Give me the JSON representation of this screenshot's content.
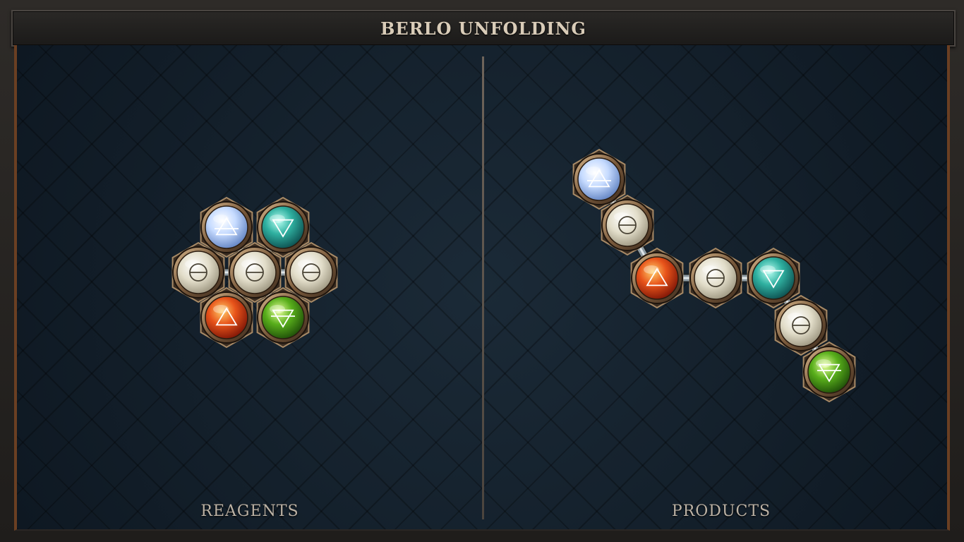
{
  "header": {
    "title": "BERLO UNFOLDING"
  },
  "panels": {
    "reagents_label": "REAGENTS",
    "products_label": "PRODUCTS"
  },
  "atom_types": {
    "air": {
      "symbol": "🜁",
      "icon": "air-triangle-icon",
      "color": "#cfe2ff"
    },
    "water": {
      "symbol": "🜄",
      "icon": "water-triangle-icon",
      "color": "#3fb6a6"
    },
    "fire": {
      "symbol": "🜂",
      "icon": "fire-triangle-icon",
      "color": "#e04a16"
    },
    "earth": {
      "symbol": "🜃",
      "icon": "earth-triangle-icon",
      "color": "#5aae1c"
    },
    "salt": {
      "symbol": "🜔",
      "icon": "salt-icon",
      "color": "#d9d4bf"
    }
  },
  "reagents": {
    "atoms": [
      "salt",
      "air",
      "water",
      "salt",
      "salt",
      "fire",
      "earth"
    ],
    "bonds": [
      [
        0,
        1
      ],
      [
        0,
        2
      ],
      [
        0,
        3
      ],
      [
        0,
        4
      ],
      [
        0,
        5
      ],
      [
        0,
        6
      ]
    ]
  },
  "products": {
    "atoms": [
      "air",
      "salt",
      "fire",
      "salt",
      "water",
      "salt",
      "earth"
    ],
    "bonds": [
      [
        0,
        1
      ],
      [
        1,
        2
      ],
      [
        2,
        3
      ],
      [
        3,
        4
      ],
      [
        4,
        5
      ],
      [
        5,
        6
      ]
    ]
  }
}
